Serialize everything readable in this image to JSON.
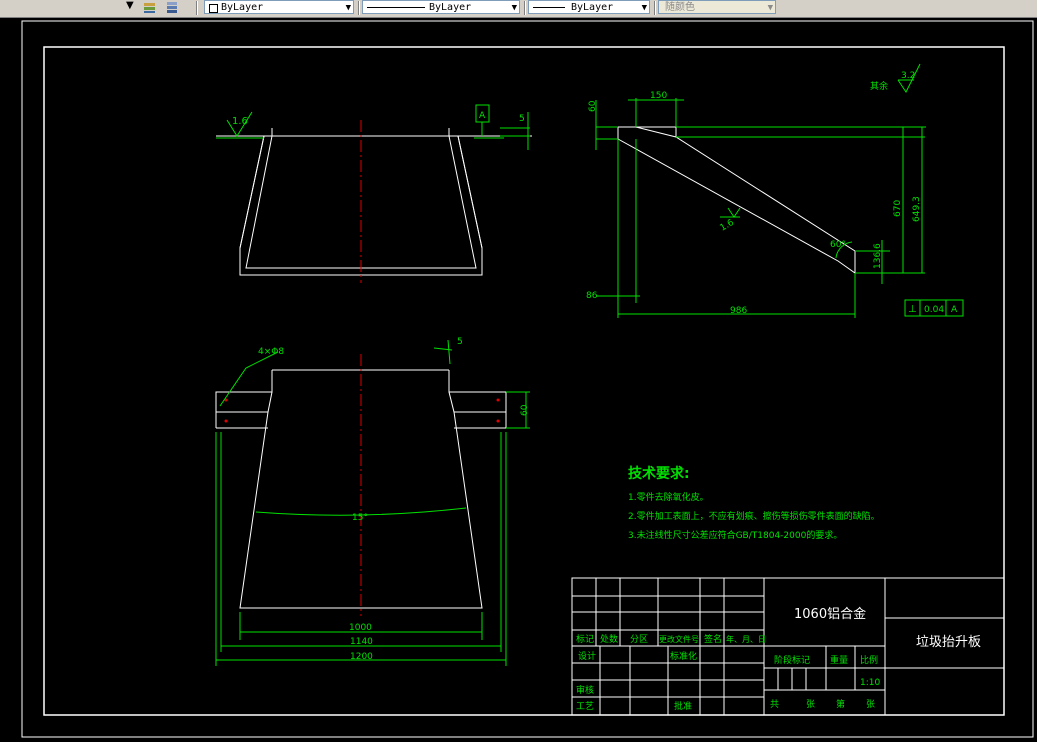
{
  "toolbar": {
    "layer_combo": "ByLayer",
    "linetype_combo": "ByLayer",
    "lineweight_combo": "ByLayer",
    "color_combo": "随颜色"
  },
  "drawing": {
    "top_view": {
      "roughness": "1.6",
      "datum": "A",
      "dim_5": "5"
    },
    "side_view": {
      "roughness_rest_label": "其余",
      "roughness_rest": "3.2",
      "dim_60": "60",
      "dim_150": "150",
      "dim_670": "670",
      "dim_649": "649.3",
      "roughness_face": "1.6",
      "angle_60": "60°",
      "dim_136": "136.6",
      "dim_86": "86",
      "dim_986": "986",
      "tol_symbol": "⊥",
      "tol_value": "0.04",
      "tol_datum": "A"
    },
    "front_view": {
      "holes": "4×Φ8",
      "angle_5": "5",
      "dim_60": "60",
      "angle_15": "15°",
      "dim_1000": "1000",
      "dim_1140": "1140",
      "dim_1200": "1200"
    },
    "tech_req": {
      "title": "技术要求:",
      "items": [
        "1.零件去除氧化皮。",
        "2.零件加工表面上，不应有划痕、擦伤等损伤零件表面的缺陷。",
        "3.未注线性尺寸公差应符合GB/T1804-2000的要求。"
      ]
    },
    "title_block": {
      "material": "1060铝合金",
      "part_name": "垃圾抬升板",
      "col_mark": "标记",
      "col_count": "处数",
      "col_zone": "分区",
      "col_doc": "更改文件号",
      "col_sign": "签名",
      "col_date": "年、月、日",
      "design": "设计",
      "standard": "标准化",
      "stage_mark": "阶段标记",
      "weight": "重量",
      "scale_label": "比例",
      "scale": "1:10",
      "review": "审核",
      "process": "工艺",
      "approve": "批准",
      "total": "共",
      "sheets": "张",
      "page": "第",
      "page_unit": "张"
    }
  }
}
